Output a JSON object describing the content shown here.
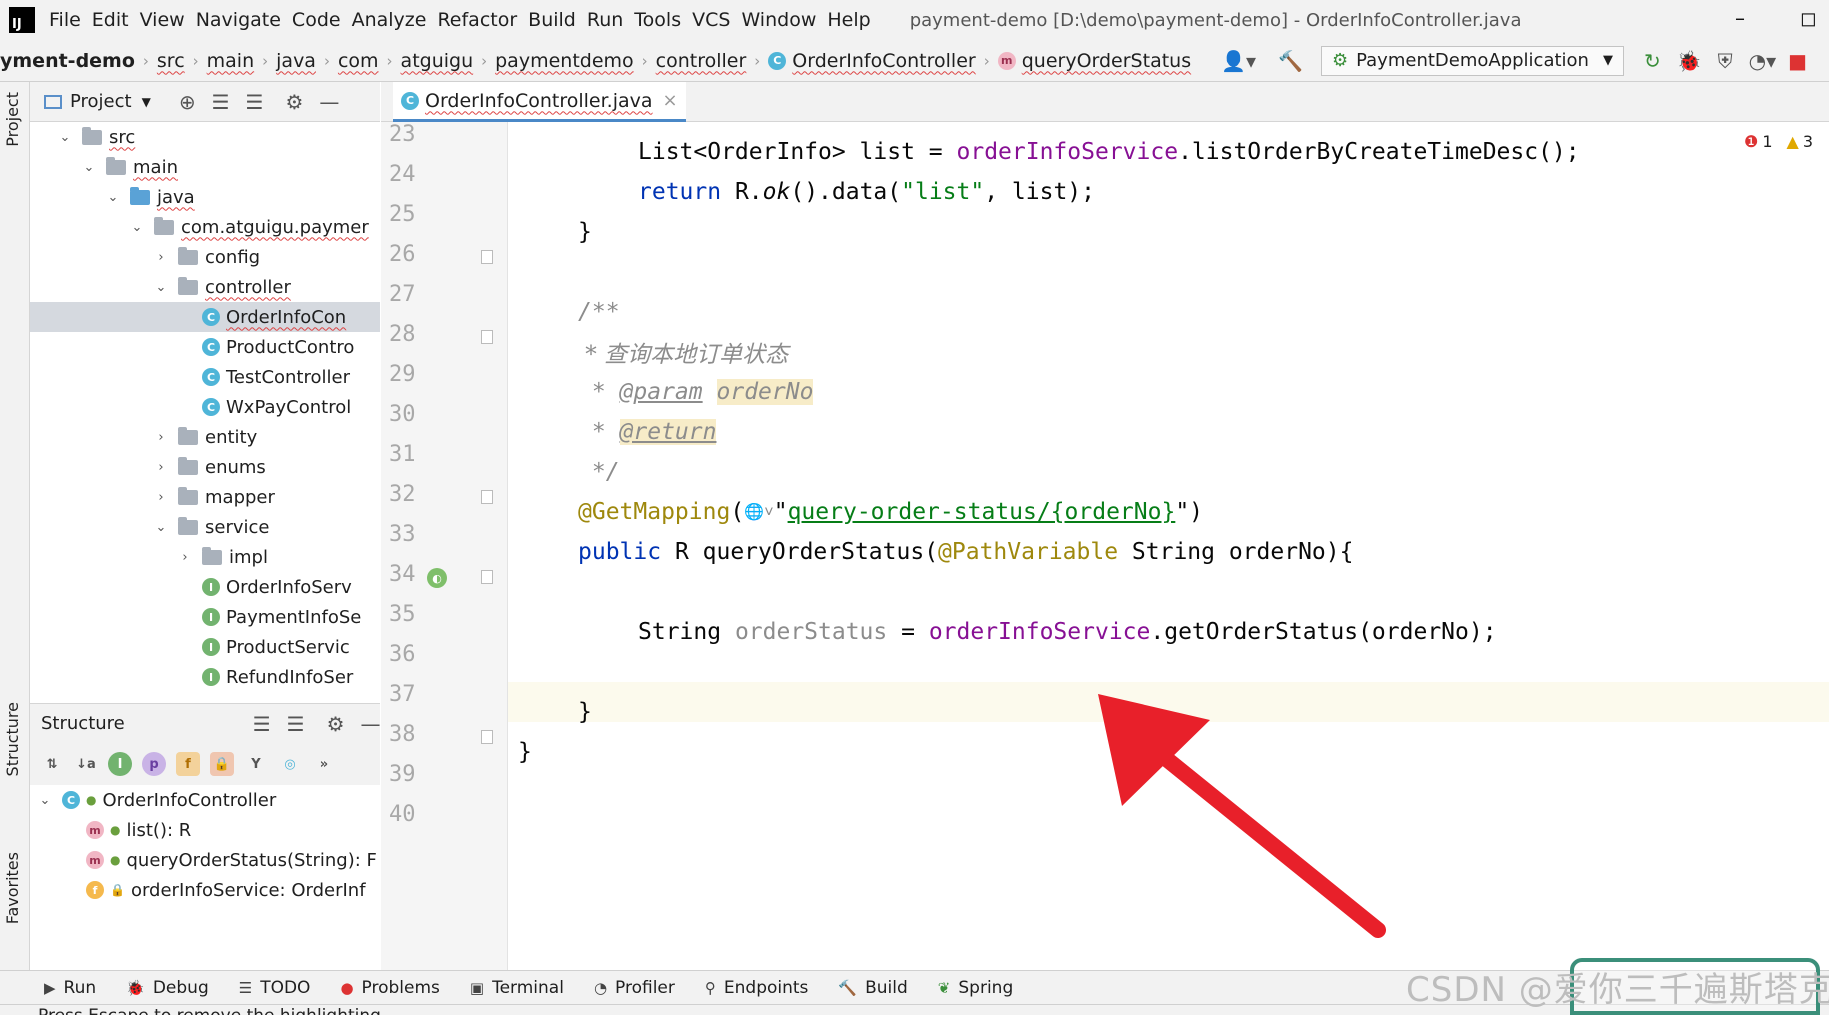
{
  "menubar": {
    "logo": "IJ",
    "items": [
      "File",
      "Edit",
      "View",
      "Navigate",
      "Code",
      "Analyze",
      "Refactor",
      "Build",
      "Run",
      "Tools",
      "VCS",
      "Window",
      "Help"
    ],
    "title": "payment-demo [D:\\demo\\payment-demo] - OrderInfoController.java",
    "minimize": "–",
    "maximize": "◻"
  },
  "breadcrumbs": {
    "items": [
      "yment-demo",
      "src",
      "main",
      "java",
      "com",
      "atguigu",
      "paymentdemo",
      "controller",
      "OrderInfoController",
      "queryOrderStatus"
    ],
    "run_config": "PaymentDemoApplication"
  },
  "project_panel": {
    "header": "Project",
    "tree": [
      {
        "label": "src",
        "level": 0,
        "expanded": true,
        "icon": "folder"
      },
      {
        "label": "main",
        "level": 1,
        "expanded": true,
        "icon": "folder"
      },
      {
        "label": "java",
        "level": 2,
        "expanded": true,
        "icon": "folder-blue"
      },
      {
        "label": "com.atguigu.paymer",
        "level": 3,
        "expanded": true,
        "icon": "package"
      },
      {
        "label": "config",
        "level": 4,
        "expanded": false,
        "icon": "folder"
      },
      {
        "label": "controller",
        "level": 4,
        "expanded": true,
        "icon": "folder"
      },
      {
        "label": "OrderInfoCon",
        "level": 5,
        "icon": "class",
        "selected": true
      },
      {
        "label": "ProductContro",
        "level": 5,
        "icon": "class"
      },
      {
        "label": "TestController",
        "level": 5,
        "icon": "class"
      },
      {
        "label": "WxPayControl",
        "level": 5,
        "icon": "class"
      },
      {
        "label": "entity",
        "level": 4,
        "expanded": false,
        "icon": "folder"
      },
      {
        "label": "enums",
        "level": 4,
        "expanded": false,
        "icon": "folder"
      },
      {
        "label": "mapper",
        "level": 4,
        "expanded": false,
        "icon": "folder"
      },
      {
        "label": "service",
        "level": 4,
        "expanded": true,
        "icon": "folder"
      },
      {
        "label": "impl",
        "level": 5,
        "expanded": false,
        "icon": "folder"
      },
      {
        "label": "OrderInfoServ",
        "level": 5,
        "icon": "interface"
      },
      {
        "label": "PaymentInfoSe",
        "level": 5,
        "icon": "interface"
      },
      {
        "label": "ProductServic",
        "level": 5,
        "icon": "interface"
      },
      {
        "label": "RefundInfoSer",
        "level": 5,
        "icon": "interface"
      }
    ]
  },
  "structure_panel": {
    "header": "Structure",
    "items": [
      {
        "label": "OrderInfoController",
        "icon": "class",
        "level": 0
      },
      {
        "label": "list(): R",
        "icon": "method",
        "level": 1
      },
      {
        "label": "queryOrderStatus(String): F",
        "icon": "method",
        "level": 1
      },
      {
        "label": "orderInfoService: OrderInf",
        "icon": "field",
        "level": 1
      }
    ]
  },
  "side_labels": {
    "project": "Project",
    "structure": "Structure",
    "favorites": "Favorites"
  },
  "editor": {
    "tab": "OrderInfoController.java",
    "tab_close": "×",
    "errors": "1",
    "warnings": "3",
    "line_numbers": [
      "23",
      "24",
      "25",
      "26",
      "27",
      "28",
      "29",
      "30",
      "31",
      "32",
      "33",
      "34",
      "35",
      "36",
      "37",
      "38",
      "39",
      "40"
    ],
    "code": {
      "l24_a": "List<OrderInfo> list = ",
      "l24_b": "orderInfoService",
      "l24_c": ".listOrderByCreateTimeDesc();",
      "l25_a": "return",
      "l25_b": " R.",
      "l25_c": "ok",
      "l25_d": "().data(",
      "l25_e": "\"list\"",
      "l25_f": ", list);",
      "l26": "}",
      "l28": "/**",
      "l29": " * 查询本地订单状态",
      "l30_a": " * ",
      "l30_b": "@param",
      "l30_c": " ",
      "l30_d": "orderNo",
      "l31_a": " * ",
      "l31_b": "@return",
      "l32": " */",
      "l33_a": "@GetMapping",
      "l33_b": "(",
      "l33_c": "\"",
      "l33_d": "query-order-status/{orderNo}",
      "l33_e": "\")",
      "l34_a": "public",
      "l34_b": " R queryOrderStatus(",
      "l34_c": "@PathVariable",
      "l34_d": " String orderNo){",
      "l36_a": "String ",
      "l36_b": "orderStatus",
      "l36_c": " = ",
      "l36_d": "orderInfoService",
      "l36_e": ".getOrderStatus(orderNo);",
      "l38": "}",
      "l39": "}"
    }
  },
  "bottom_toolbar": {
    "items": [
      "Run",
      "Debug",
      "TODO",
      "Problems",
      "Terminal",
      "Profiler",
      "Endpoints",
      "Build",
      "Spring"
    ]
  },
  "status_text": "Press Escape to remove the highlighting",
  "watermark": "CSDN @爱你三千遍斯塔克",
  "colors": {
    "keyword": "#0033b3",
    "field": "#871094",
    "string": "#067d17",
    "annotation": "#9e880d",
    "comment": "#8c8c8c",
    "arrow": "#e8202a"
  }
}
